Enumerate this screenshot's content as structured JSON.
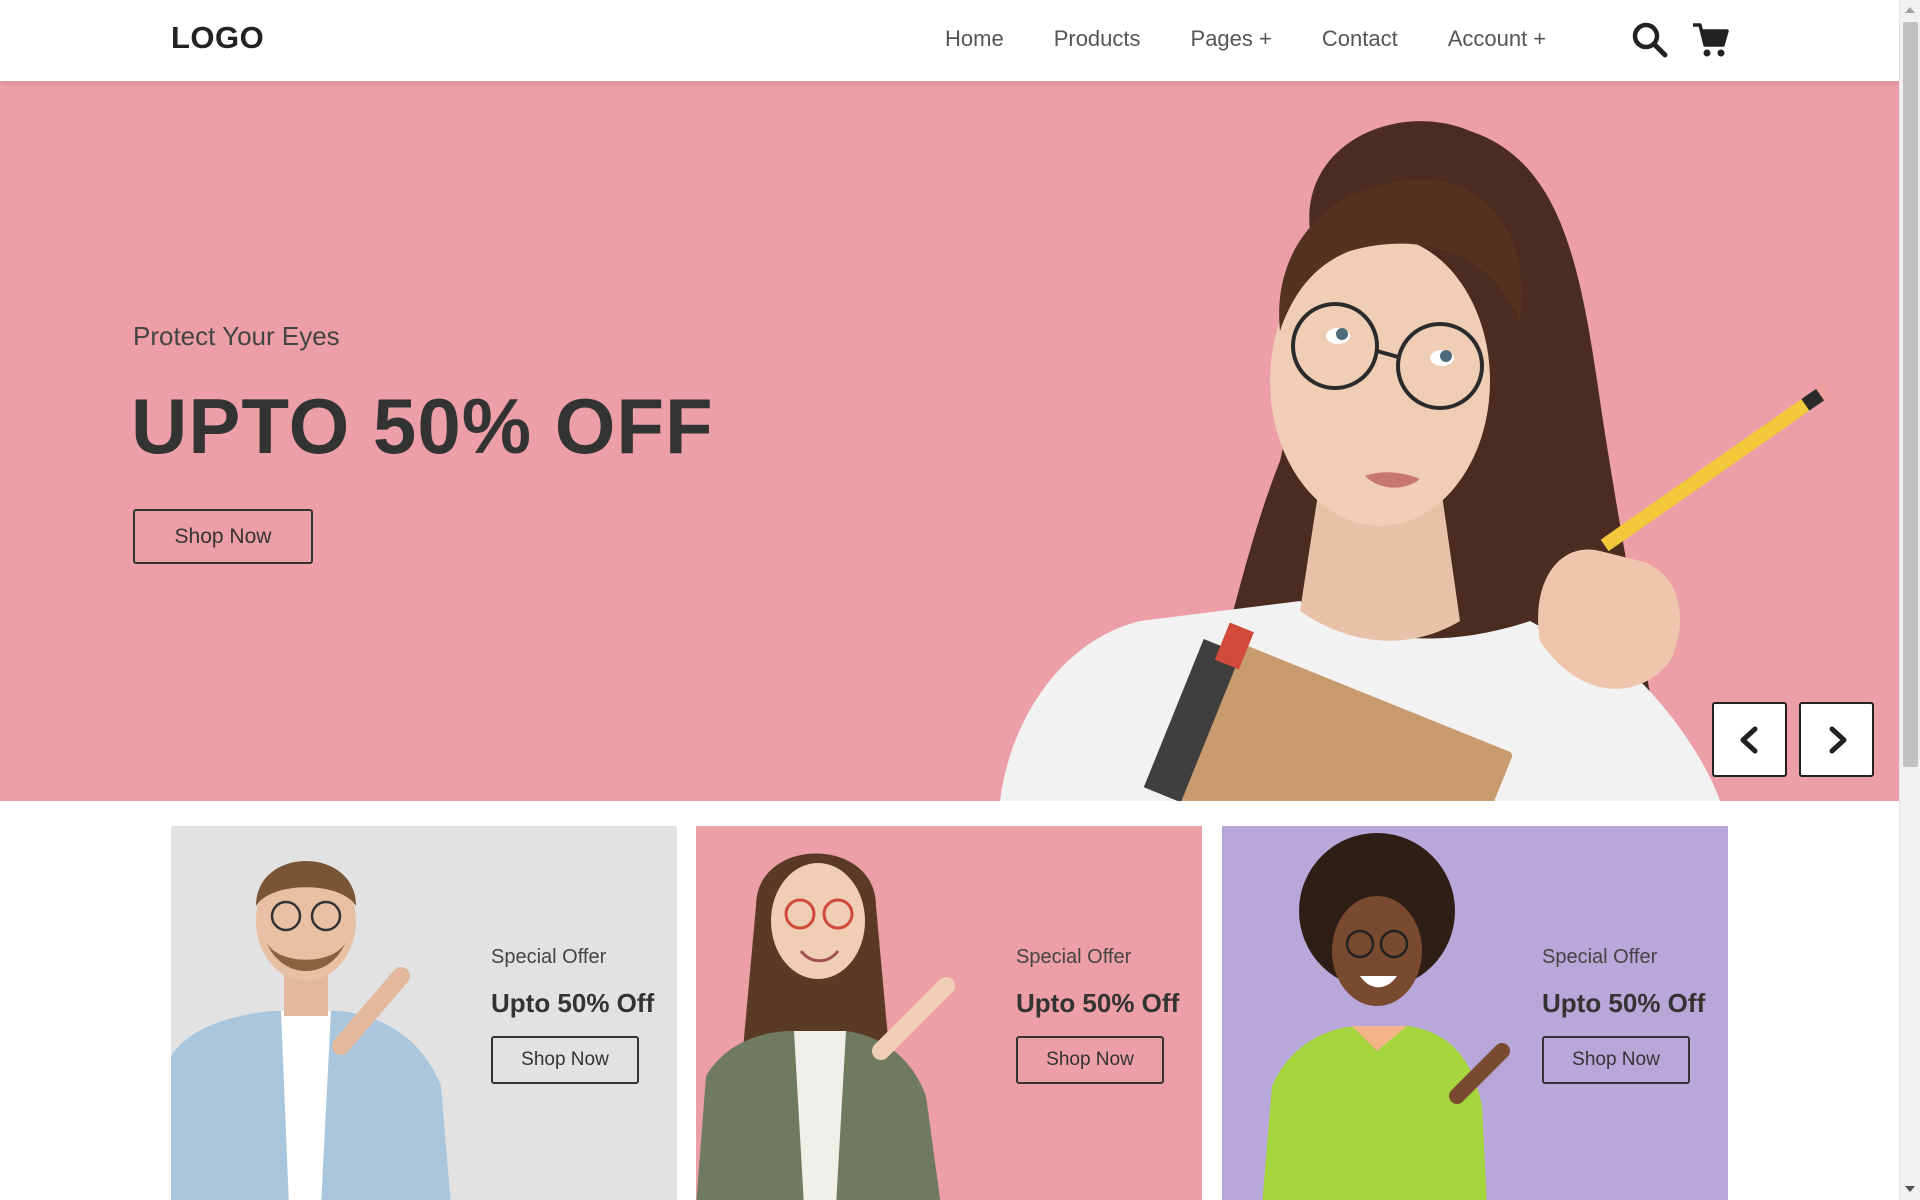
{
  "header": {
    "logo": "LOGO",
    "nav": [
      {
        "label": "Home"
      },
      {
        "label": "Products"
      },
      {
        "label": "Pages +"
      },
      {
        "label": "Contact"
      },
      {
        "label": "Account +"
      }
    ],
    "icons": [
      "search-icon",
      "cart-icon"
    ]
  },
  "hero": {
    "subtitle": "Protect Your Eyes",
    "title": "UPTO 50% OFF",
    "button": "Shop Now",
    "background": "#ed9fa7",
    "controls": [
      "chevron-left-icon",
      "chevron-right-icon"
    ]
  },
  "cards": [
    {
      "eyebrow": "Special Offer",
      "title": "Upto 50% Off",
      "button": "Shop Now",
      "background": "#e2e2e2"
    },
    {
      "eyebrow": "Special Offer",
      "title": "Upto 50% Off",
      "button": "Shop Now",
      "background": "#ed9fa7"
    },
    {
      "eyebrow": "Special Offer",
      "title": "Upto 50% Off",
      "button": "Shop Now",
      "background": "#b8a7d9"
    }
  ]
}
